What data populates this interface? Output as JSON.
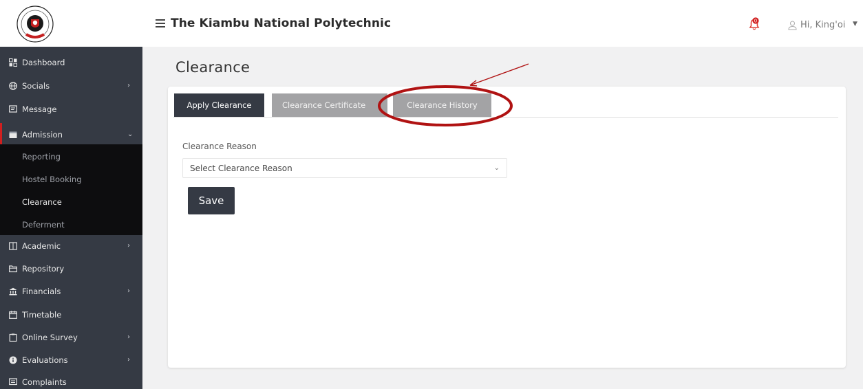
{
  "header": {
    "app_title": "The Kiambu National Polytechnic",
    "user_greeting": "Hi, King'oi",
    "notification_count": "0"
  },
  "sidebar": {
    "items": [
      {
        "label": "Dashboard",
        "icon": "dashboard-icon",
        "has_children": false
      },
      {
        "label": "Socials",
        "icon": "globe-icon",
        "has_children": true
      },
      {
        "label": "Message",
        "icon": "message-icon",
        "has_children": false
      },
      {
        "label": "Admission",
        "icon": "admission-icon",
        "has_children": true,
        "expanded": true
      },
      {
        "label": "Academic",
        "icon": "book-icon",
        "has_children": true
      },
      {
        "label": "Repository",
        "icon": "folder-icon",
        "has_children": false
      },
      {
        "label": "Financials",
        "icon": "bank-icon",
        "has_children": true
      },
      {
        "label": "Timetable",
        "icon": "calendar-icon",
        "has_children": false
      },
      {
        "label": "Online Survey",
        "icon": "clipboard-icon",
        "has_children": true
      },
      {
        "label": "Evaluations",
        "icon": "info-icon",
        "has_children": true
      },
      {
        "label": "Complaints",
        "icon": "complaints-icon",
        "has_children": false
      }
    ],
    "admission_submenu": [
      "Reporting",
      "Hostel Booking",
      "Clearance",
      "Deferment"
    ]
  },
  "main": {
    "page_title": "Clearance",
    "tabs": [
      {
        "label": "Apply Clearance",
        "active": true
      },
      {
        "label": "Clearance Certificate",
        "active": false
      },
      {
        "label": "Clearance History",
        "active": false
      }
    ],
    "form": {
      "reason_label": "Clearance Reason",
      "reason_select_value": "Select Clearance Reason",
      "save_label": "Save"
    }
  },
  "colors": {
    "sidebar_bg": "#353a44",
    "submenu_bg": "#0d0d0f",
    "active_accent": "#d11f1f",
    "annotation": "#b01212",
    "tab_inactive": "#a3a3a5"
  }
}
